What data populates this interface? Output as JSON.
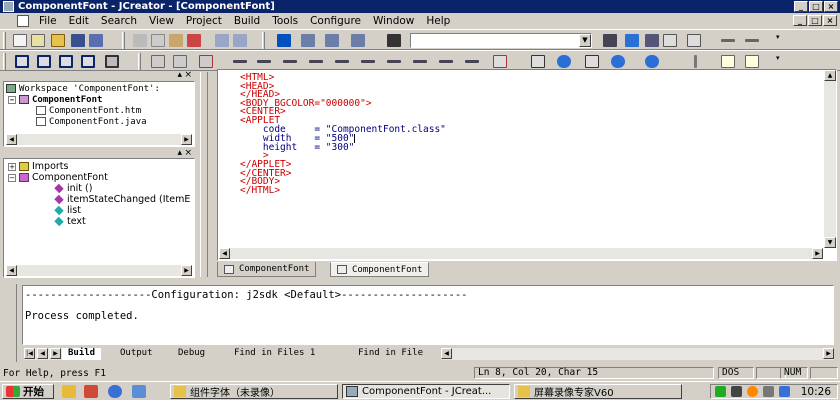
{
  "window": {
    "title": "ComponentFont - JCreator - [ComponentFont]"
  },
  "menu": [
    "File",
    "Edit",
    "Search",
    "View",
    "Project",
    "Build",
    "Tools",
    "Configure",
    "Window",
    "Help"
  ],
  "workspace": {
    "root": "Workspace 'ComponentFont':",
    "project": "ComponentFont",
    "files": [
      "ComponentFont.htm",
      "ComponentFont.java"
    ]
  },
  "classview": {
    "imports": "Imports",
    "class": "ComponentFont",
    "members": [
      "init ()",
      "itemStateChanged (ItemE",
      "list",
      "text"
    ]
  },
  "editor": {
    "lines": [
      "<HTML>",
      "<HEAD>",
      "</HEAD>",
      "<BODY BGCOLOR=\"000000\">",
      "<CENTER>",
      "<APPLET",
      "    code     = \"ComponentFont.class\"",
      "    width    = \"500\"",
      "    height   = \"300\"",
      "    >",
      "</APPLET>",
      "</CENTER>",
      "</BODY>",
      "</HTML>"
    ],
    "tabs": [
      "ComponentFont",
      "ComponentFont"
    ]
  },
  "output": {
    "config_line": "--------------------Configuration: j2sdk <Default>--------------------",
    "status_line": "Process completed.",
    "tabs": [
      "Build",
      "Output",
      "Debug",
      "Find in Files 1",
      "Find in File"
    ]
  },
  "statusbar": {
    "help": "For Help, press F1",
    "position": "Ln 8, Col 20, Char 15",
    "dos": "DOS",
    "num": "NUM"
  },
  "taskbar": {
    "start": "开始",
    "tasks": [
      "组件字体（未录像）",
      "ComponentFont - JCreat...",
      "屏幕录像专家V60"
    ],
    "clock": "10:26"
  },
  "colors": {
    "titlebar": "#0a246a",
    "tag": "#cc0000",
    "attr": "#000080"
  }
}
